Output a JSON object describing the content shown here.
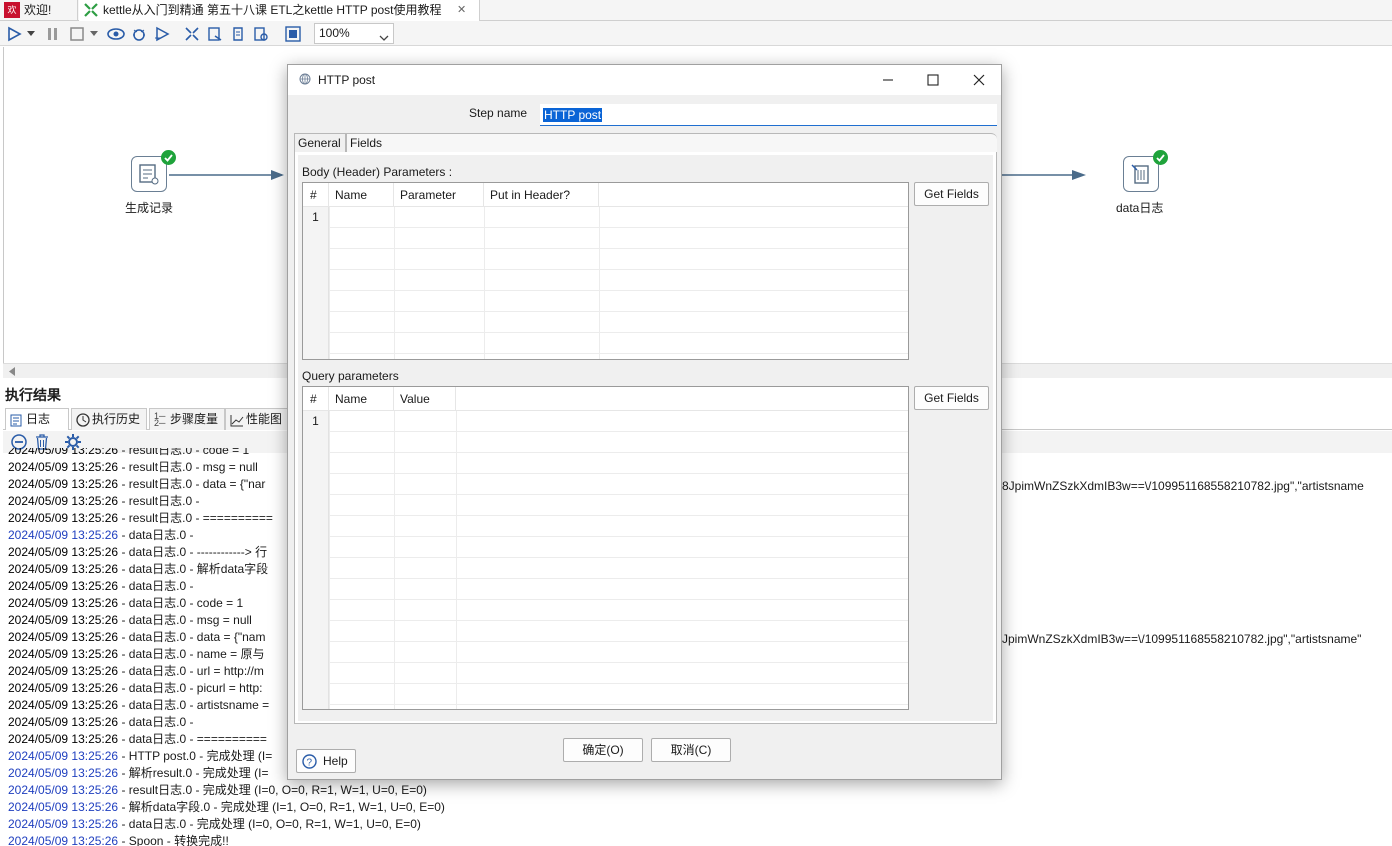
{
  "tabs": [
    {
      "label": "欢迎!"
    },
    {
      "label": "kettle从入门到精通 第五十八课 ETL之kettle HTTP post使用教程"
    }
  ],
  "toolbar": {
    "zoom": "100%"
  },
  "canvas": {
    "nodes": [
      {
        "label": "生成记录"
      },
      {
        "label": "data日志"
      }
    ]
  },
  "results": {
    "title": "执行结果",
    "tabs": [
      "日志",
      "执行历史",
      "步骤度量",
      "性能图"
    ],
    "log": [
      {
        "ts": "2024/05/09 13:25:26",
        "text": " - result日志.0 - code = 1",
        "blue": false,
        "partial_top": true
      },
      {
        "ts": "2024/05/09 13:25:26",
        "text": " - result日志.0 - msg = null",
        "blue": false
      },
      {
        "ts": "2024/05/09 13:25:26",
        "text": " - result日志.0 - data = {\"nar",
        "blue": false
      },
      {
        "ts": "2024/05/09 13:25:26",
        "text": " - result日志.0 -",
        "blue": false
      },
      {
        "ts": "2024/05/09 13:25:26",
        "text": " - result日志.0 - ==========",
        "blue": false
      },
      {
        "ts": "2024/05/09 13:25:26",
        "text": " - data日志.0 -",
        "blue": true
      },
      {
        "ts": "2024/05/09 13:25:26",
        "text": " - data日志.0 - ------------> 行",
        "blue": false
      },
      {
        "ts": "2024/05/09 13:25:26",
        "text": " - data日志.0 - 解析data字段",
        "blue": false
      },
      {
        "ts": "2024/05/09 13:25:26",
        "text": " - data日志.0 -",
        "blue": false
      },
      {
        "ts": "2024/05/09 13:25:26",
        "text": " - data日志.0 - code = 1",
        "blue": false
      },
      {
        "ts": "2024/05/09 13:25:26",
        "text": " - data日志.0 - msg = null",
        "blue": false
      },
      {
        "ts": "2024/05/09 13:25:26",
        "text": " - data日志.0 - data = {\"nam",
        "blue": false
      },
      {
        "ts": "2024/05/09 13:25:26",
        "text": " - data日志.0 - name = 原与",
        "blue": false
      },
      {
        "ts": "2024/05/09 13:25:26",
        "text": " - data日志.0 - url = http://m",
        "blue": false
      },
      {
        "ts": "2024/05/09 13:25:26",
        "text": " - data日志.0 - picurl = http:",
        "blue": false
      },
      {
        "ts": "2024/05/09 13:25:26",
        "text": " - data日志.0 - artistsname =",
        "blue": false
      },
      {
        "ts": "2024/05/09 13:25:26",
        "text": " - data日志.0 -",
        "blue": false
      },
      {
        "ts": "2024/05/09 13:25:26",
        "text": " - data日志.0 - ==========",
        "blue": false
      },
      {
        "ts": "2024/05/09 13:25:26",
        "text": " - HTTP post.0 - 完成处理 (I=",
        "blue": true
      },
      {
        "ts": "2024/05/09 13:25:26",
        "text": " - 解析result.0 - 完成处理 (I=",
        "blue": true
      },
      {
        "ts": "2024/05/09 13:25:26",
        "text": " - result日志.0 - 完成处理 (I=0, O=0, R=1, W=1, U=0, E=0)",
        "blue": true
      },
      {
        "ts": "2024/05/09 13:25:26",
        "text": " - 解析data字段.0 - 完成处理 (I=1, O=0, R=1, W=1, U=0, E=0)",
        "blue": true
      },
      {
        "ts": "2024/05/09 13:25:26",
        "text": " - data日志.0 - 完成处理 (I=0, O=0, R=1, W=1, U=0, E=0)",
        "blue": true
      },
      {
        "ts": "2024/05/09 13:25:26",
        "text": " - Spoon - 转换完成!!",
        "blue": true
      }
    ],
    "log_right": [
      "8JpimWnZSzkXdmIB3w==\\/109951168558210782.jpg\",\"artistsname",
      "JpimWnZSzkXdmIB3w==\\/109951168558210782.jpg\",\"artistsname\""
    ]
  },
  "dialog": {
    "title": "HTTP post",
    "step_name_label": "Step name",
    "step_name_value": "HTTP post",
    "tabs": [
      "General",
      "Fields"
    ],
    "body_section_label": "Body (Header) Parameters :",
    "body_columns": [
      "#",
      "Name",
      "Parameter",
      "Put in Header?"
    ],
    "body_rows": [
      "1"
    ],
    "query_section_label": "Query parameters",
    "query_columns": [
      "#",
      "Name",
      "Value"
    ],
    "query_rows": [
      "1"
    ],
    "get_fields_label": "Get Fields",
    "ok_label": "确定(O)",
    "cancel_label": "取消(C)",
    "help_label": "Help"
  }
}
